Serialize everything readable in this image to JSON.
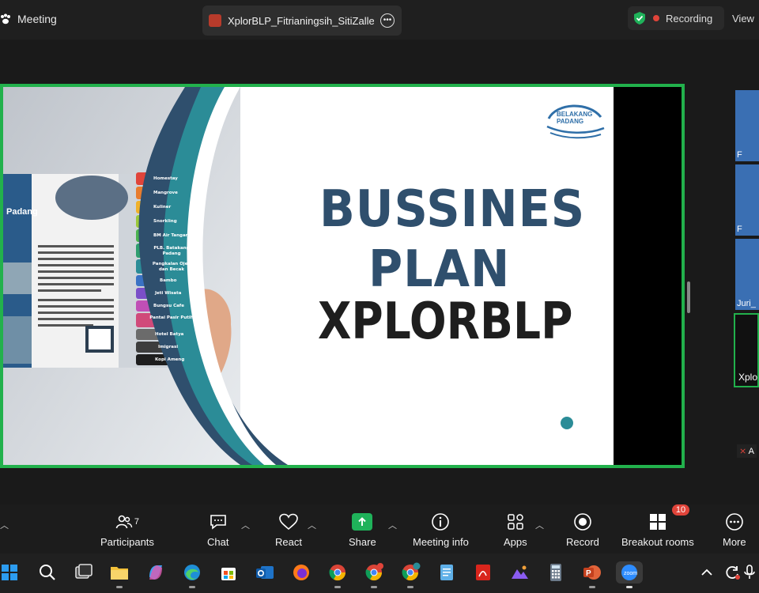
{
  "topbar": {
    "meeting_label": "Meeting",
    "share_title": "XplorBLP_Fitrianingsih_SitiZalleha",
    "recording_label": "Recording",
    "view_label": "View"
  },
  "slide": {
    "title_line1": "BUSSINES",
    "title_line2": "PLAN",
    "title_line3": "XPLORBLP",
    "logo_text": "BELAKANG PADANG",
    "brochure_heading": "Padang",
    "brochure_items": [
      "Homestay",
      "Mangrove",
      "Kuliner",
      "Snorkling",
      "BM Air Tangan",
      "PLB. Batakang Padang",
      "Pangkalan Ojek dan Becak",
      "Bambo",
      "Jeti Wisata",
      "Bungsu Cafe",
      "Pantai Pasir Putih",
      "Hotel Batya",
      "Imigrasi",
      "Kopi Ameng"
    ],
    "accent_colors": [
      "#2f4f6d",
      "#1e1e1e",
      "#2b8c97",
      "#22b14c"
    ]
  },
  "gallery": {
    "names": [
      "F",
      "F",
      "Juri_",
      "Xplo"
    ],
    "muted_name": "A"
  },
  "toolbar": {
    "participants_label": "Participants",
    "participants_count": "7",
    "chat_label": "Chat",
    "react_label": "React",
    "share_label": "Share",
    "meeting_info_label": "Meeting info",
    "apps_label": "Apps",
    "record_label": "Record",
    "breakout_label": "Breakout rooms",
    "breakout_badge": "10",
    "more_label": "More"
  },
  "taskbar": {
    "icons": [
      "windows-icon",
      "search-icon",
      "task-view-icon",
      "file-explorer-icon",
      "copilot-icon",
      "edge-icon",
      "store-icon",
      "outlook-icon",
      "firefox-icon",
      "chrome-icon",
      "chrome-profile-icon",
      "chrome-profile-m-icon",
      "notepad-icon",
      "acrobat-icon",
      "photos-icon",
      "calculator-icon",
      "powerpoint-icon",
      "zoom-icon"
    ],
    "tray": [
      "chevron-up-icon",
      "refresh-icon",
      "mic-icon"
    ]
  }
}
